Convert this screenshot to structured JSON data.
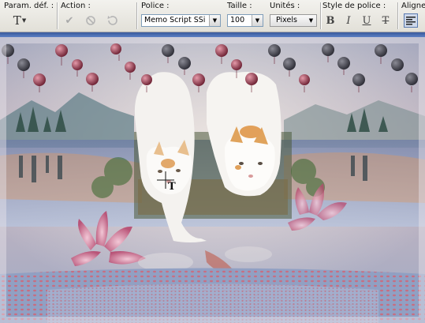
{
  "toolbar": {
    "param_label": "Param. déf. :",
    "param_tool_glyph": "T",
    "action_label": "Action :",
    "font_label": "Police :",
    "font_value": "Memo Script SSi",
    "size_label": "Taille :",
    "size_value": "100",
    "units_label": "Unités :",
    "units_value": "Pixels",
    "font_style_label": "Style de police :",
    "align_label": "Aligner"
  },
  "icons": [
    "text-tool-icon",
    "apply-check-icon",
    "cancel-icon",
    "restart-icon",
    "bold-icon",
    "italic-icon",
    "underline-icon",
    "strikethrough-icon",
    "align-left-icon",
    "dropdown-arrow-icon"
  ],
  "colors": {
    "accent": "#3a5a9c",
    "toolbar_bg": "#e9e7e0",
    "canvas_sky": "#8a9bb8"
  },
  "cursor": {
    "glyph": "T"
  }
}
